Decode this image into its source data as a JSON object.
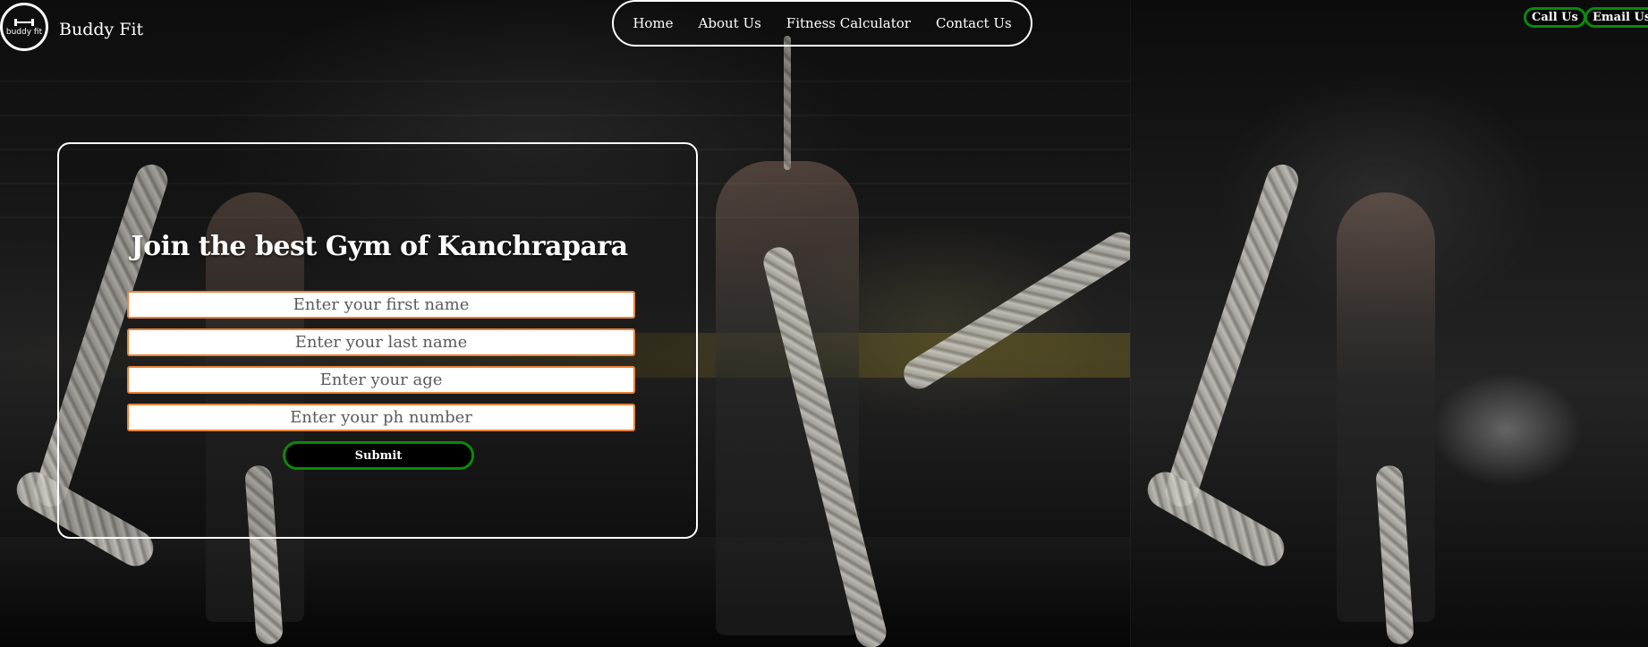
{
  "header": {
    "logo_text": "buddy fit",
    "brand_name": "Buddy Fit",
    "nav": [
      {
        "label": "Home"
      },
      {
        "label": "About Us"
      },
      {
        "label": "Fitness Calculator"
      },
      {
        "label": "Contact Us"
      }
    ],
    "call_label": "Call Us",
    "email_label": "Email Us"
  },
  "form": {
    "title": "Join the best Gym of Kanchrapara",
    "first_name_placeholder": "Enter your first name",
    "last_name_placeholder": "Enter your last name",
    "age_placeholder": "Enter your age",
    "phone_placeholder": "Enter your ph number",
    "submit_label": "Submit"
  },
  "colors": {
    "button_border": "#0a8a0a",
    "field_border": "#e8823a",
    "text": "#ffffff"
  }
}
